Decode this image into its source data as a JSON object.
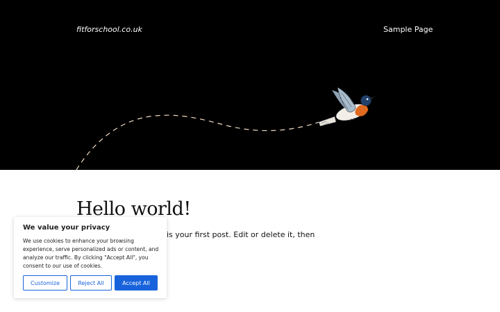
{
  "header": {
    "site_title": "fitforschool.co.uk",
    "nav": [
      {
        "label": "Sample Page"
      }
    ],
    "background": "#000000"
  },
  "post": {
    "title": "Hello world!",
    "excerpt_visible": "is your first post. Edit or delete it, then"
  },
  "cookie_banner": {
    "title": "We value your privacy",
    "text": "We use cookies to enhance your browsing experience, serve personalized ads or content, and analyze our traffic. By clicking \"Accept All\", you consent to our use of cookies.",
    "buttons": {
      "customize": "Customize",
      "reject": "Reject All",
      "accept": "Accept All"
    },
    "accent_color": "#1863dc"
  }
}
